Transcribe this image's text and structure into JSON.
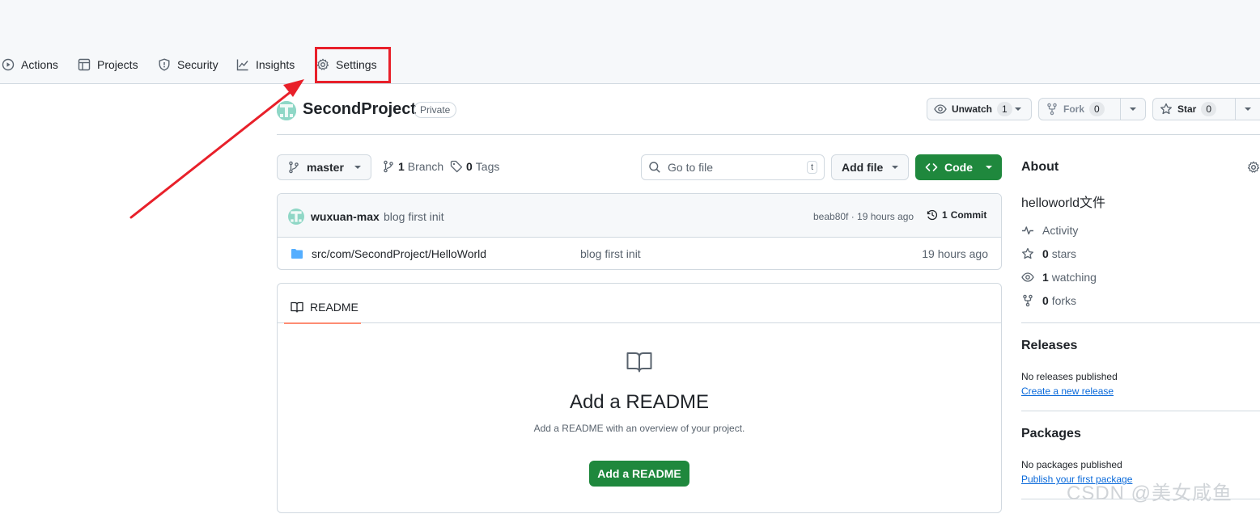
{
  "nav": {
    "tabs": [
      {
        "label": "Actions",
        "icon": "play-circle-icon"
      },
      {
        "label": "Projects",
        "icon": "table-icon"
      },
      {
        "label": "Security",
        "icon": "shield-icon"
      },
      {
        "label": "Insights",
        "icon": "graph-icon"
      },
      {
        "label": "Settings",
        "icon": "gear-icon"
      }
    ],
    "highlight_color": "#e8202a"
  },
  "repo": {
    "name": "SecondProject",
    "visibility": "Private",
    "watch": {
      "label": "Unwatch",
      "count": "1"
    },
    "fork": {
      "label": "Fork",
      "count": "0"
    },
    "star": {
      "label": "Star",
      "count": "0"
    }
  },
  "toolbar": {
    "branch": "master",
    "branch_count": "1",
    "branch_label": "Branch",
    "tag_count": "0",
    "tag_label": "Tags",
    "search_placeholder": "Go to file",
    "search_shortcut": "t",
    "add_file": "Add file",
    "code": "Code",
    "code_color": "#1f883d"
  },
  "commit": {
    "author": "wuxuan-max",
    "message": "blog first init",
    "hash_time": "beab80f · 19 hours ago",
    "commit_count": "1",
    "commit_label": "Commit"
  },
  "files": [
    {
      "name": "src/com/SecondProject/HelloWorld",
      "message": "blog first init",
      "time": "19 hours ago",
      "icon": "folder-icon"
    }
  ],
  "readme": {
    "tab": "README",
    "title": "Add a README",
    "description": "Add a README with an overview of your project.",
    "button": "Add a README"
  },
  "about": {
    "heading": "About",
    "description": "helloworld文件",
    "activity": "Activity",
    "stars_count": "0",
    "stars_label": "stars",
    "watching_count": "1",
    "watching_label": "watching",
    "forks_count": "0",
    "forks_label": "forks"
  },
  "releases": {
    "heading": "Releases",
    "text": "No releases published",
    "link": "Create a new release"
  },
  "packages": {
    "heading": "Packages",
    "text": "No packages published",
    "link": "Publish your first package"
  },
  "watermark": "CSDN @美女咸鱼"
}
